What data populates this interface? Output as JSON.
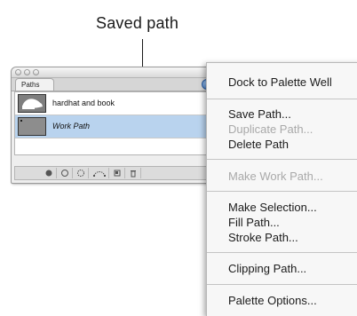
{
  "callout": {
    "text": "Saved path"
  },
  "palette": {
    "tab_label": "Paths",
    "rows": [
      {
        "label": "hardhat and book",
        "selected": false
      },
      {
        "label": "Work Path",
        "selected": true
      }
    ],
    "bottom_buttons": [
      "fill-path-icon",
      "stroke-path-icon",
      "load-selection-icon",
      "make-work-path-icon",
      "new-path-icon",
      "trash-icon"
    ]
  },
  "menu": {
    "items": [
      {
        "label": "Dock to Palette Well",
        "enabled": true
      },
      {
        "label": "Save Path...",
        "enabled": true
      },
      {
        "label": "Duplicate Path...",
        "enabled": false
      },
      {
        "label": "Delete Path",
        "enabled": true
      },
      {
        "label": "Make Work Path...",
        "enabled": false
      },
      {
        "label": "Make Selection...",
        "enabled": true
      },
      {
        "label": "Fill Path...",
        "enabled": true
      },
      {
        "label": "Stroke Path...",
        "enabled": true
      },
      {
        "label": "Clipping Path...",
        "enabled": true
      },
      {
        "label": "Palette Options...",
        "enabled": true
      }
    ]
  }
}
